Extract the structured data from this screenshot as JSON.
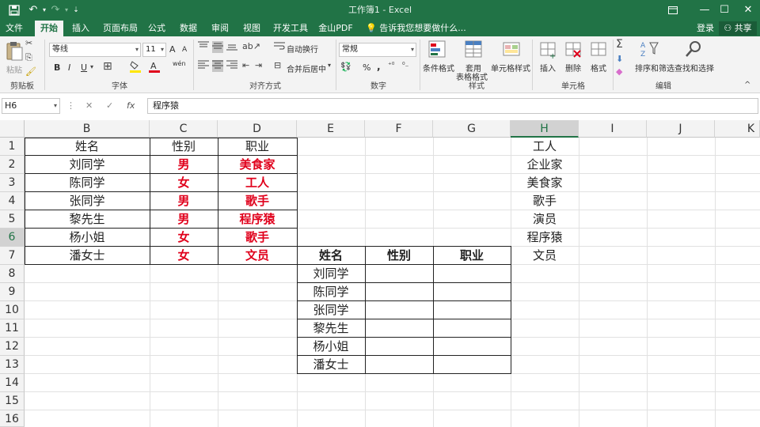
{
  "app": {
    "title": "工作簿1 - Excel"
  },
  "quick_access": {
    "save_icon": "save-icon",
    "undo_icon": "undo-icon",
    "redo_icon": "redo-icon"
  },
  "tabs": [
    "文件",
    "开始",
    "插入",
    "页面布局",
    "公式",
    "数据",
    "审阅",
    "视图",
    "开发工具",
    "金山PDF"
  ],
  "active_tab": "开始",
  "tell_me": "告诉我您想要做什么...",
  "login": "登录",
  "share": "共享",
  "ribbon": {
    "clipboard": {
      "paste": "粘贴",
      "label": "剪贴板"
    },
    "font": {
      "name": "等线",
      "size": "11",
      "bold": "B",
      "italic": "I",
      "underline": "U",
      "label": "字体",
      "increase": "A",
      "decrease": "A",
      "phonetic": "wén"
    },
    "alignment": {
      "wrap": "自动换行",
      "merge": "合并后居中",
      "label": "对齐方式"
    },
    "number": {
      "format": "常规",
      "percent": "%",
      "comma": ",",
      "label": "数字"
    },
    "styles": {
      "cond": "条件格式",
      "table1": "套用",
      "table2": "表格格式",
      "cell": "单元格样式",
      "label": "样式"
    },
    "cells": {
      "insert": "插入",
      "delete": "删除",
      "format": "格式",
      "label": "单元格"
    },
    "editing": {
      "sort": "排序和筛选",
      "find": "查找和选择",
      "label": "编辑"
    }
  },
  "formula_bar": {
    "name_box": "H6",
    "fx": "fx",
    "content": "程序猿"
  },
  "columns": [
    "B",
    "C",
    "D",
    "E",
    "F",
    "G",
    "H",
    "I",
    "J",
    "K"
  ],
  "rows": [
    "1",
    "2",
    "3",
    "4",
    "5",
    "6",
    "7",
    "8",
    "9",
    "10",
    "11",
    "12",
    "13",
    "14",
    "15",
    "16"
  ],
  "table1": {
    "headers": [
      "姓名",
      "性别",
      "职业"
    ],
    "rows": [
      [
        "刘同学",
        "男",
        "美食家"
      ],
      [
        "陈同学",
        "女",
        "工人"
      ],
      [
        "张同学",
        "男",
        "歌手"
      ],
      [
        "黎先生",
        "男",
        "程序猿"
      ],
      [
        "杨小姐",
        "女",
        "歌手"
      ],
      [
        "潘女士",
        "女",
        "文员"
      ]
    ]
  },
  "table2": {
    "headers": [
      "姓名",
      "性别",
      "职业"
    ],
    "names": [
      "刘同学",
      "陈同学",
      "张同学",
      "黎先生",
      "杨小姐",
      "潘女士"
    ]
  },
  "column_h": [
    "工人",
    "企业家",
    "美食家",
    "歌手",
    "演员",
    "程序猿",
    "文员"
  ],
  "colors": {
    "excel_green": "#217346",
    "red_text": "#e0001b"
  }
}
